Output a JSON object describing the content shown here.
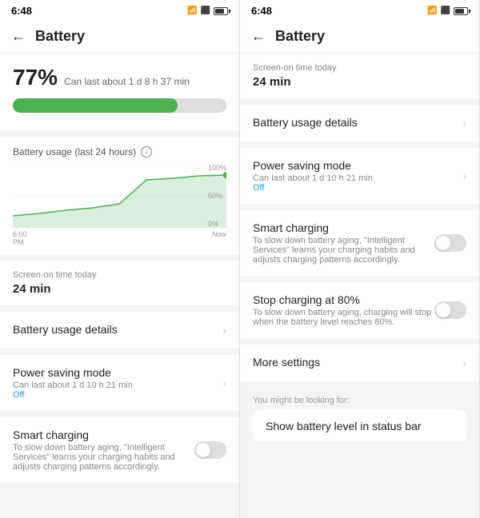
{
  "left_panel": {
    "status": {
      "time": "6:48",
      "icons": [
        "wifi",
        "vpn",
        "battery"
      ]
    },
    "header": {
      "back_label": "←",
      "title": "Battery"
    },
    "battery_level": {
      "percentage": "77%",
      "estimate": "Can last about 1 d 8 h 37 min",
      "bar_fill": 77
    },
    "chart": {
      "title": "Battery usage (last 24 hours)",
      "x_labels": [
        "6:00\nPM",
        "Now"
      ],
      "y_labels": [
        "100%",
        "50%",
        "0%"
      ]
    },
    "screen_on": {
      "label": "Screen-on time today",
      "value": "24 min"
    },
    "items": [
      {
        "title": "Battery usage details",
        "has_chevron": true
      },
      {
        "title": "Power saving mode",
        "subtitle": "Can last about 1 d 10 h 21 min",
        "status": "Off",
        "has_chevron": true
      },
      {
        "title": "Smart charging",
        "desc": "To slow down battery aging, \"Intelligent Services\" learns your charging habits and adjusts charging patterns accordingly.",
        "has_toggle": true
      }
    ]
  },
  "right_panel": {
    "status": {
      "time": "6:48"
    },
    "header": {
      "back_label": "←",
      "title": "Battery"
    },
    "items": [
      {
        "label": "Screen-on time today",
        "value": "24 min"
      },
      {
        "title": "Battery usage details",
        "has_chevron": true
      },
      {
        "title": "Power saving mode",
        "desc": "Can last about 1 d 10 h 21 min",
        "status": "Off",
        "status_color": "blue",
        "has_chevron": true
      },
      {
        "title": "Smart charging",
        "desc": "To slow down battery aging, \"Intelligent Services\" learns your charging habits and adjusts charging patterns accordingly.",
        "has_toggle": true
      },
      {
        "title": "Stop charging at 80%",
        "desc": "To slow down battery aging, charging will stop when the battery level reaches 80%.",
        "has_toggle": true
      },
      {
        "title": "More settings",
        "has_chevron": true
      }
    ],
    "you_might": {
      "label": "You might be looking for:",
      "item": "Show battery level in status bar"
    }
  }
}
